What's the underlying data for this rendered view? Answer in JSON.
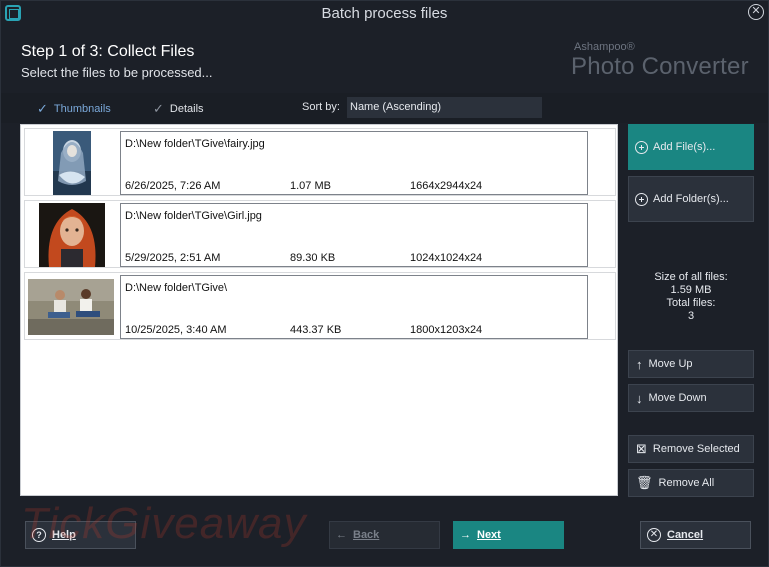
{
  "window": {
    "title": "Batch process files"
  },
  "header": {
    "step_title": "Step 1 of 3: Collect Files",
    "step_subtitle": "Select the files to be processed...",
    "brand_small": "Ashampoo®",
    "brand_large": "Photo Converter"
  },
  "viewbar": {
    "thumbnails_label": "Thumbnails",
    "details_label": "Details",
    "sortby_label": "Sort by:",
    "sortby_value": "Name (Ascending)"
  },
  "files": [
    {
      "path": "D:\\New folder\\TGive\\fairy.jpg",
      "date": "6/26/2025, 7:26 AM",
      "size": "1.07 MB",
      "dims": "1664x2944x24"
    },
    {
      "path": "D:\\New folder\\TGive\\Girl.jpg",
      "date": "5/29/2025, 2:51 AM",
      "size": "89.30 KB",
      "dims": "1024x1024x24"
    },
    {
      "path": "D:\\New folder\\TGive\\",
      "date": "10/25/2025, 3:40 AM",
      "size": "443.37 KB",
      "dims": "1800x1203x24"
    }
  ],
  "sidebar": {
    "add_files": "Add File(s)...",
    "add_folder": "Add Folder(s)...",
    "size_label": "Size of all files:",
    "size_value": "1.59 MB",
    "total_label": "Total files:",
    "total_value": "3",
    "move_up": "Move Up",
    "move_down": "Move Down",
    "remove_selected": "Remove Selected",
    "remove_all": "Remove All"
  },
  "footer": {
    "help": "Help",
    "back": "Back",
    "next": "Next",
    "cancel": "Cancel"
  },
  "watermark": "TickGiveaway",
  "colors": {
    "accent": "#1a8682",
    "background": "#1c2028",
    "button": "#2b313b"
  }
}
